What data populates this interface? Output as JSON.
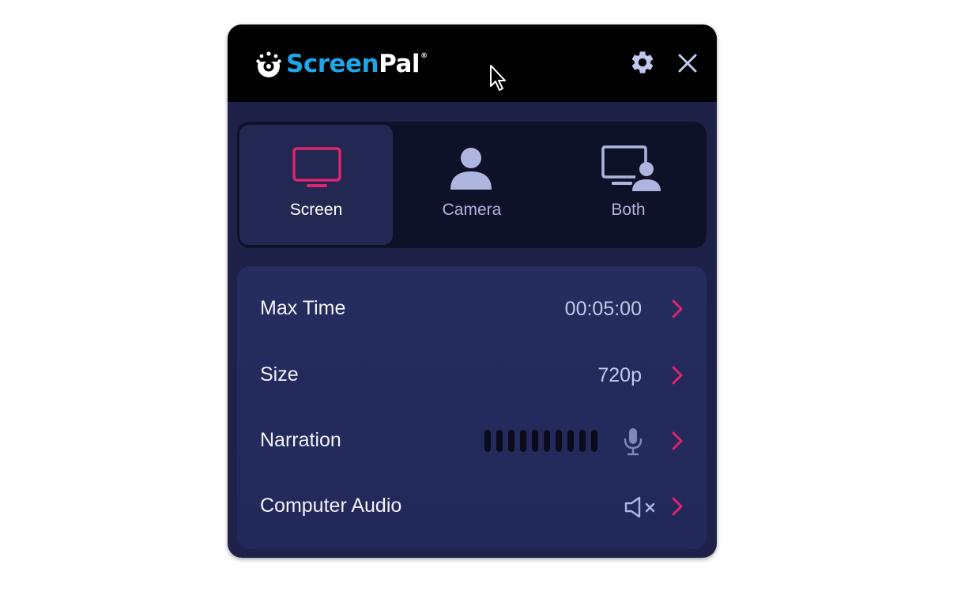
{
  "app": {
    "logo_text_part1": "Screen",
    "logo_text_part2": "Pal",
    "logo_reg": "®"
  },
  "titlebar": {
    "settings_icon": "gear-icon",
    "close_icon": "close-icon"
  },
  "modes": [
    {
      "label": "Screen",
      "icon": "monitor-icon",
      "active": true
    },
    {
      "label": "Camera",
      "icon": "person-icon",
      "active": false
    },
    {
      "label": "Both",
      "icon": "monitor-person-icon",
      "active": false
    }
  ],
  "settings": {
    "max_time": {
      "label": "Max Time",
      "value": "00:05:00"
    },
    "size": {
      "label": "Size",
      "value": "720p"
    },
    "narration": {
      "label": "Narration",
      "meter_level": 0,
      "icon": "microphone-icon"
    },
    "computer_audio": {
      "label": "Computer Audio",
      "icon": "speaker-muted-icon"
    }
  },
  "colors": {
    "accent": "#e0246e",
    "brand_blue": "#1ea6e8",
    "panel_bg": "#1e2248",
    "icon_muted": "#aeb6df"
  }
}
